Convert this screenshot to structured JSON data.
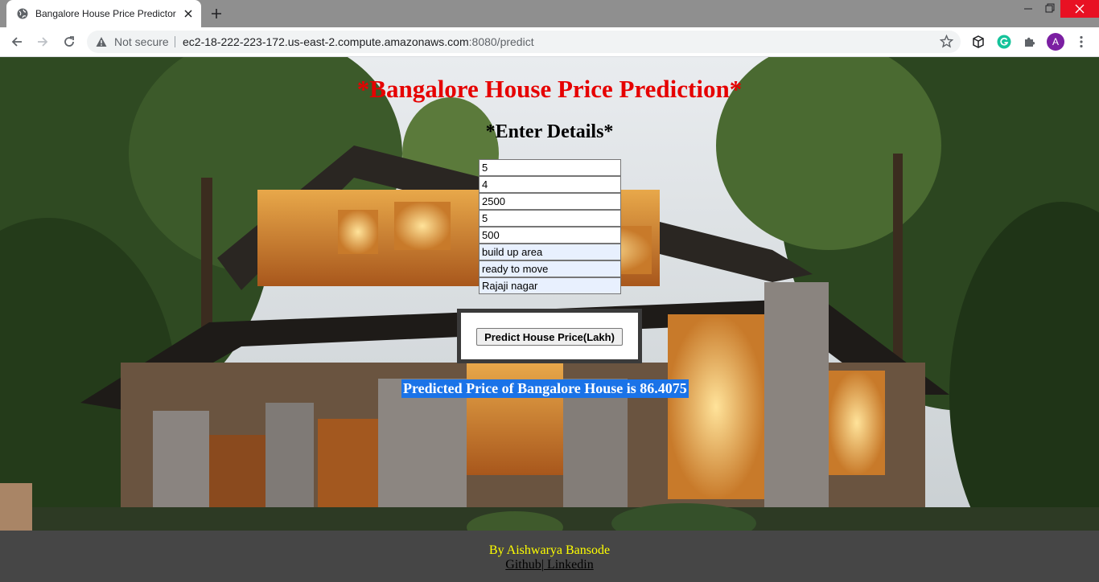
{
  "browser": {
    "tab_title": "Bangalore House Price Predictor",
    "security_label": "Not secure",
    "url_host": "ec2-18-222-223-172.us-east-2.compute.amazonaws.com",
    "url_rest": ":8080/predict",
    "profile_initial": "A",
    "icons": [
      "globe-icon",
      "close-icon",
      "plus-icon",
      "minimize-icon",
      "maximize-icon",
      "window-close-icon",
      "back-icon",
      "forward-icon",
      "reload-icon",
      "warning-icon",
      "star-icon",
      "cube-extension-icon",
      "grammarly-icon",
      "puzzle-icon",
      "more-icon"
    ]
  },
  "page": {
    "title": "*Bangalore House Price Prediction*",
    "subtitle": "*Enter Details*",
    "fields": [
      "5",
      "4",
      "2500",
      "5",
      "500",
      "build up area",
      "ready to move",
      "Rajaji nagar"
    ],
    "button_label": "Predict House Price(Lakh)",
    "result_text": "Predicted Price of Bangalore House is 86.4075"
  },
  "footer": {
    "author": "By Aishwarya Bansode",
    "github_label": "Github",
    "separator": "|",
    "linkedin_label": " Linkedin"
  },
  "colors": {
    "title": "#e60000",
    "result_highlight": "#1a73e8",
    "footer_bg": "#464646",
    "author": "#ffff00"
  }
}
